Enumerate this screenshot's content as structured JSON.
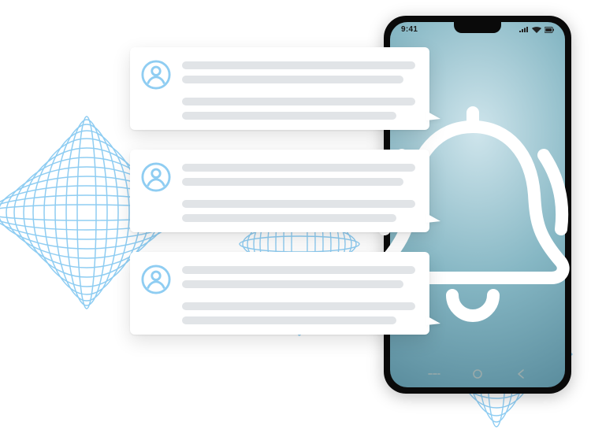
{
  "phone": {
    "statusbar": {
      "time": "9:41",
      "icons": {
        "signal": "signal-icon",
        "wifi": "wifi-icon",
        "battery": "battery-icon"
      }
    },
    "navbar": {
      "recents": "recents-icon",
      "home": "home-icon",
      "back": "back-icon"
    }
  },
  "notifications": [
    {
      "avatar": "user-avatar-icon"
    },
    {
      "avatar": "user-avatar-icon"
    },
    {
      "avatar": "user-avatar-icon"
    }
  ],
  "decoration": {
    "bell": "bell-icon",
    "waves": [
      "wave-left",
      "wave-mid",
      "wave-right"
    ],
    "colors": {
      "wave": "#8fcdf2",
      "bubble": "#ffffff",
      "placeholder": "#e1e4e7",
      "avatarStroke": "#8fcdf2"
    }
  }
}
